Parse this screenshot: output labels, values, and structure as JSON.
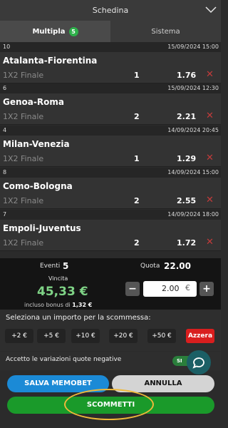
{
  "header": {
    "title": "Schedina",
    "collapse_icon": "chevron-down-icon"
  },
  "tabs": [
    {
      "label": "Multipla",
      "badge": "5",
      "active": true
    },
    {
      "label": "Sistema",
      "active": false
    }
  ],
  "events": [
    {
      "num": "10",
      "date": "15/09/2024 15:00",
      "match": "Atalanta-Fiorentina",
      "market": "1X2 Finale",
      "pick": "1",
      "odd": "1.76"
    },
    {
      "num": "6",
      "date": "15/09/2024 12:30",
      "match": "Genoa-Roma",
      "market": "1X2 Finale",
      "pick": "2",
      "odd": "2.21"
    },
    {
      "num": "4",
      "date": "14/09/2024 20:45",
      "match": "Milan-Venezia",
      "market": "1X2 Finale",
      "pick": "1",
      "odd": "1.29"
    },
    {
      "num": "8",
      "date": "14/09/2024 15:00",
      "match": "Como-Bologna",
      "market": "1X2 Finale",
      "pick": "2",
      "odd": "2.55"
    },
    {
      "num": "7",
      "date": "14/09/2024 18:00",
      "match": "Empoli-Juventus",
      "market": "1X2 Finale",
      "pick": "2",
      "odd": "1.72"
    }
  ],
  "summary": {
    "eventi_label": "Eventi",
    "eventi_value": "5",
    "quota_label": "Quota",
    "quota_value": "22.00",
    "vincita_label": "Vincita",
    "vincita_value": "45,33 €",
    "bonus_label": "incluso bonus di",
    "bonus_value": "1,32 €",
    "amount_value": "2.00",
    "currency": "€",
    "minus": "−",
    "plus": "+"
  },
  "importo": {
    "label": "Seleziona un importo per la scommessa:",
    "chips": [
      "+2 €",
      "+5 €",
      "+10 €",
      "+20 €",
      "+50 €"
    ],
    "reset": "Azzera"
  },
  "accept": {
    "label": "Accetto le variazioni quote negative",
    "toggle": "SI"
  },
  "buttons": {
    "save": "SALVA MEMOBET",
    "cancel": "ANNULLA",
    "bet": "SCOMMETTI"
  },
  "colors": {
    "win": "#7fd386",
    "badge": "#2eb04a",
    "bet": "#1a9a2a",
    "save": "#1b8ad6",
    "reset": "#d91e1e",
    "highlight_ring": "#f0b93a"
  }
}
